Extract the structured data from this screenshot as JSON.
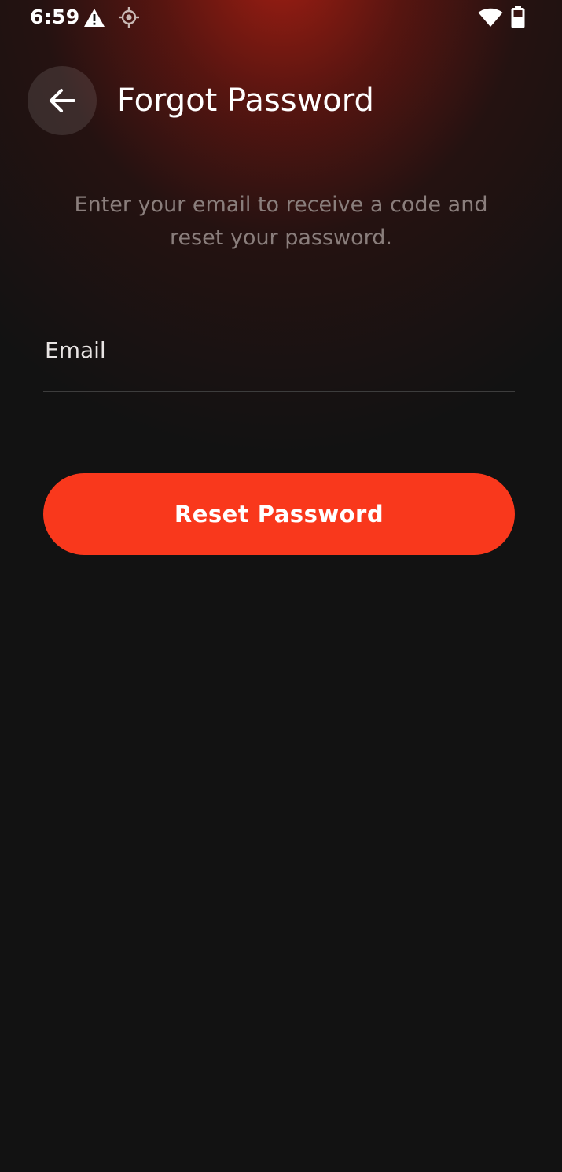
{
  "status_bar": {
    "time": "6:59",
    "icons": [
      "warning-icon",
      "location-target-icon",
      "wifi-icon",
      "battery-icon"
    ]
  },
  "header": {
    "back_icon": "arrow-left-icon",
    "title": "Forgot Password"
  },
  "main": {
    "subtitle": "Enter your email to receive a code and reset your password.",
    "email_field": {
      "placeholder": "Email",
      "value": ""
    },
    "reset_button_label": "Reset Password"
  },
  "colors": {
    "accent": "#f9381c",
    "background": "#121212",
    "header_glow": "#8a1c14",
    "subtitle_text": "#8a7e7c"
  }
}
